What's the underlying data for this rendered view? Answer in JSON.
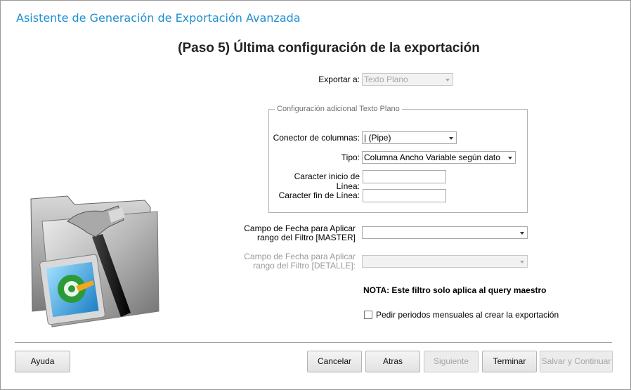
{
  "window": {
    "title": "Asistente de Generación de Exportación Avanzada"
  },
  "step": {
    "title": "(Paso 5)  Última configuración de la exportación"
  },
  "export": {
    "label": "Exportar a:",
    "value": "Texto Plano"
  },
  "group": {
    "legend": "Configuración adicional Texto Plano",
    "connector": {
      "label": "Conector de columnas:",
      "value": "| (Pipe)"
    },
    "type": {
      "label": "Tipo:",
      "value": "Columna Ancho Variable según dato"
    },
    "line_start": {
      "label": "Caracter inicio de Línea:",
      "value": ""
    },
    "line_end": {
      "label": "Caracter fin de Línea:",
      "value": ""
    }
  },
  "master_date": {
    "label_line1": "Campo de Fecha para Aplicar",
    "label_line2": "rango del Filtro [MASTER]",
    "value": ""
  },
  "detail_date": {
    "label_line1": "Campo de Fecha para Aplicar",
    "label_line2": "rango del Filtro [DETALLE]:",
    "value": ""
  },
  "note": "NOTA: Este filtro solo aplica al query maestro",
  "monthly": {
    "label": "Pedir periodos mensuales al crear la exportación",
    "checked": false
  },
  "buttons": {
    "help": "Ayuda",
    "cancel": "Cancelar",
    "back": "Atras",
    "next": "Siguiente",
    "finish": "Terminar",
    "save_continue": "Salvar y Continuar"
  },
  "illustration_icon": "folder-with-hammer-icon"
}
